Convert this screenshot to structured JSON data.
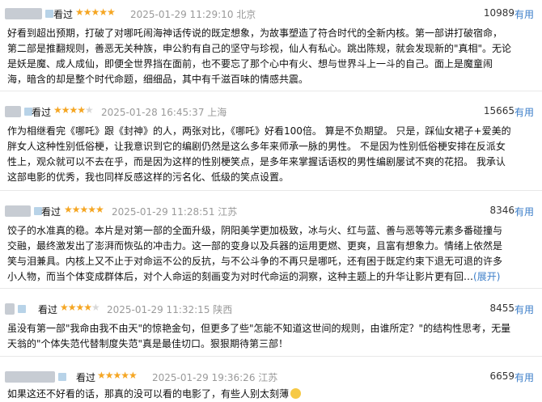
{
  "useful_label": "有用",
  "star_color": "#f5a623",
  "link_color": "#3b7ec9",
  "reviews": [
    {
      "status": "看过",
      "rating": 5,
      "time": "2025-01-29 11:29:10",
      "location": "北京",
      "count": "10989",
      "lines": [
        "好看到超出预期，打破了对哪吒闹海神话传说的既定想象，为故事塑造了符合时代的全新内核。第一部讲打破宿命，",
        "第二部是推翻规则，善恶无关种族，申公豹有自己的坚守与珍视，仙人有私心。跳出陈规，就会发现新的\"真相\"。无论",
        "是妖是魔、成人成仙，即便全世界挡在面前，也不要忘了那个心中有火、想与世界斗上一斗的自己。面上是魔童闹",
        "海，暗含的却是整个时代命题，细细品，其中有千滋百味的情感共震。"
      ],
      "expand": ""
    },
    {
      "status": "看过",
      "rating": 4,
      "time": "2025-01-28 16:45:37",
      "location": "上海",
      "count": "15665",
      "lines": [
        "作为相继看完《哪吒》跟《封神》的人，两张对比，《哪吒》好看100倍。 算是不负期望。 只是，踩仙女裙子+爱美的",
        "胖女人这种性别低俗梗，让我意识到它的编剧仍然是这么多年来师承一脉的男性。 不是因为性别低俗梗安排在反派女",
        "性上，观众就可以不去在乎，而是因为这样的性别梗笑点，是多年来掌握话语权的男性编剧屡试不爽的花招。 我承认",
        "这部电影的优秀，我也同样反感这样的污名化、低级的笑点设置。"
      ],
      "expand": ""
    },
    {
      "status": "看过",
      "rating": 5,
      "time": "2025-01-29 11:28:51",
      "location": "江苏",
      "count": "8346",
      "lines": [
        "饺子的水准真的稳。本片是对第一部的全面升级，阴阳美学更加极致，冰与火、红与蓝、善与恶等等元素多番碰撞与",
        "交融，最终激发出了澎湃而恢弘的冲击力。这一部的变身以及兵器的运用更燃、更爽，且富有想象力。情绪上依然是",
        "笑与泪兼具。内核上又不止于对命运不公的反抗，与不公斗争的不再只是哪吒，还有困于既定约束下退无可退的许多",
        "小人物，而当个体变成群体后，对个人命运的刻画变为对时代命运的洞察，这种主题上的升华让影片更有回…"
      ],
      "expand": "(展开)"
    },
    {
      "status": "看过",
      "rating": 4,
      "time": "2025-01-29 11:32:15",
      "location": "陕西",
      "count": "8455",
      "lines": [
        "虽没有第一部\"我命由我不由天\"的惊艳金句，但更多了些\"怎能不知道这世间的规则，由谁所定？\"的结构性思考，无量",
        "天翁的\"个体失范代替制度失范\"真是最佳切口。狠狠期待第三部！"
      ],
      "expand": ""
    },
    {
      "status": "看过",
      "rating": 5,
      "time": "2025-01-29 19:36:26",
      "location": "江苏",
      "count": "6659",
      "lines": [
        "如果这还不好看的话，那真的没可以看的电影了，有些人别太刻薄"
      ],
      "expand": "",
      "emoji": "grinning-face-icon"
    }
  ]
}
